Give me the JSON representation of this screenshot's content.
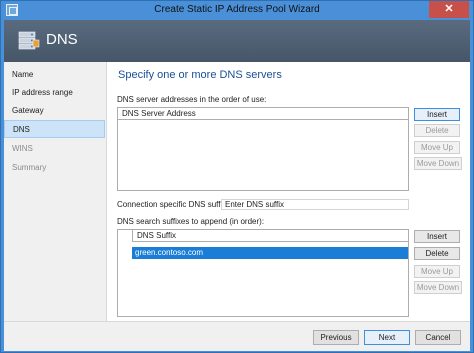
{
  "window": {
    "title": "Create Static IP Address Pool Wizard",
    "close_glyph": "✕"
  },
  "header": {
    "title": "DNS"
  },
  "nav": {
    "items": [
      {
        "label": "Name",
        "state": "normal"
      },
      {
        "label": "IP address range",
        "state": "normal"
      },
      {
        "label": "Gateway",
        "state": "normal"
      },
      {
        "label": "DNS",
        "state": "active"
      },
      {
        "label": "WINS",
        "state": "disabled"
      },
      {
        "label": "Summary",
        "state": "disabled"
      }
    ]
  },
  "main": {
    "heading": "Specify one or more DNS servers",
    "dns_servers": {
      "label": "DNS server addresses in the order of use:",
      "column_header": "DNS Server Address",
      "rows": [],
      "buttons": {
        "insert": "Insert",
        "delete": "Delete",
        "move_up": "Move Up",
        "move_down": "Move Down"
      }
    },
    "connection_suffix": {
      "label": "Connection specific DNS suffix:",
      "placeholder": "Enter DNS suffix",
      "value": ""
    },
    "search_suffixes": {
      "label": "DNS search suffixes to append (in order):",
      "column_header": "DNS Suffix",
      "rows": [
        "green.contoso.com"
      ],
      "buttons": {
        "insert": "Insert",
        "delete": "Delete",
        "move_up": "Move Up",
        "move_down": "Move Down"
      }
    }
  },
  "footer": {
    "previous": "Previous",
    "next": "Next",
    "cancel": "Cancel"
  },
  "colors": {
    "accent": "#4a90d9",
    "selection": "#1a7dd6",
    "heading": "#1a4f96",
    "header_band": "#52637a",
    "close": "#c7504b"
  },
  "icons": {
    "app": "wizard-window-icon",
    "header": "dns-server-icon",
    "close": "close-icon"
  }
}
